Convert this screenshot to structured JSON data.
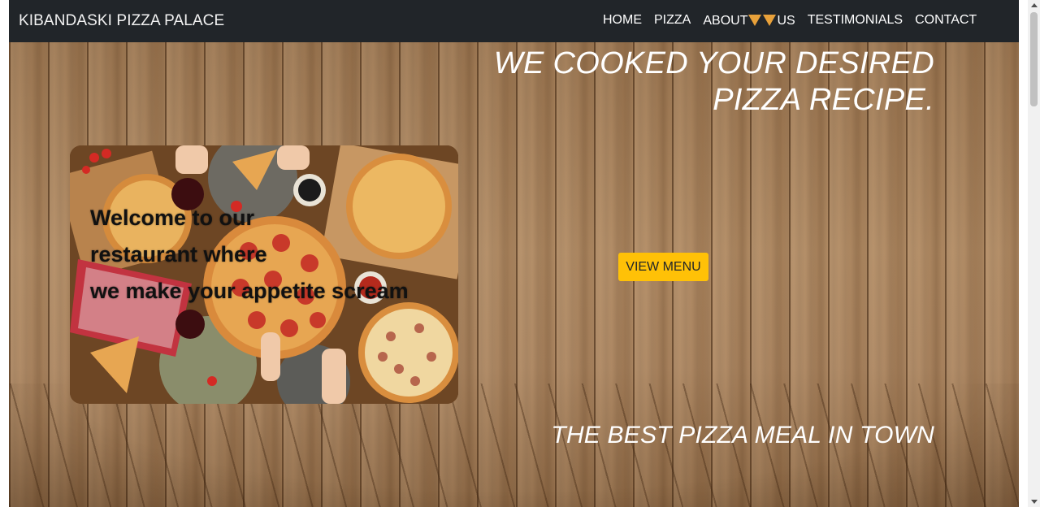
{
  "navbar": {
    "brand": "KIBANDASKI PIZZA PALACE",
    "links": {
      "home": "HOME",
      "pizza": "PIZZA",
      "about_prefix": "ABOUT",
      "about_suffix": "US",
      "testimonials": "TESTIMONIALS",
      "contact": "CONTACT"
    },
    "about_icon": "pizza-slice-icon"
  },
  "hero": {
    "headline_line1": "WE COOKED YOUR DESIRED",
    "headline_line2": "PIZZA RECIPE.",
    "welcome_line1": "Welcome to our",
    "welcome_line2": "restaurant where",
    "welcome_line3": "we make your appetite scream",
    "view_menu_label": "VIEW MENU",
    "tagline": "THE BEST PIZZA MEAL IN TOWN",
    "background": "wood-plank-texture",
    "image": "pizza-table-photo"
  },
  "colors": {
    "navbar_bg": "#212529",
    "button_bg": "#ffc107",
    "wood": "#a57f5a"
  }
}
